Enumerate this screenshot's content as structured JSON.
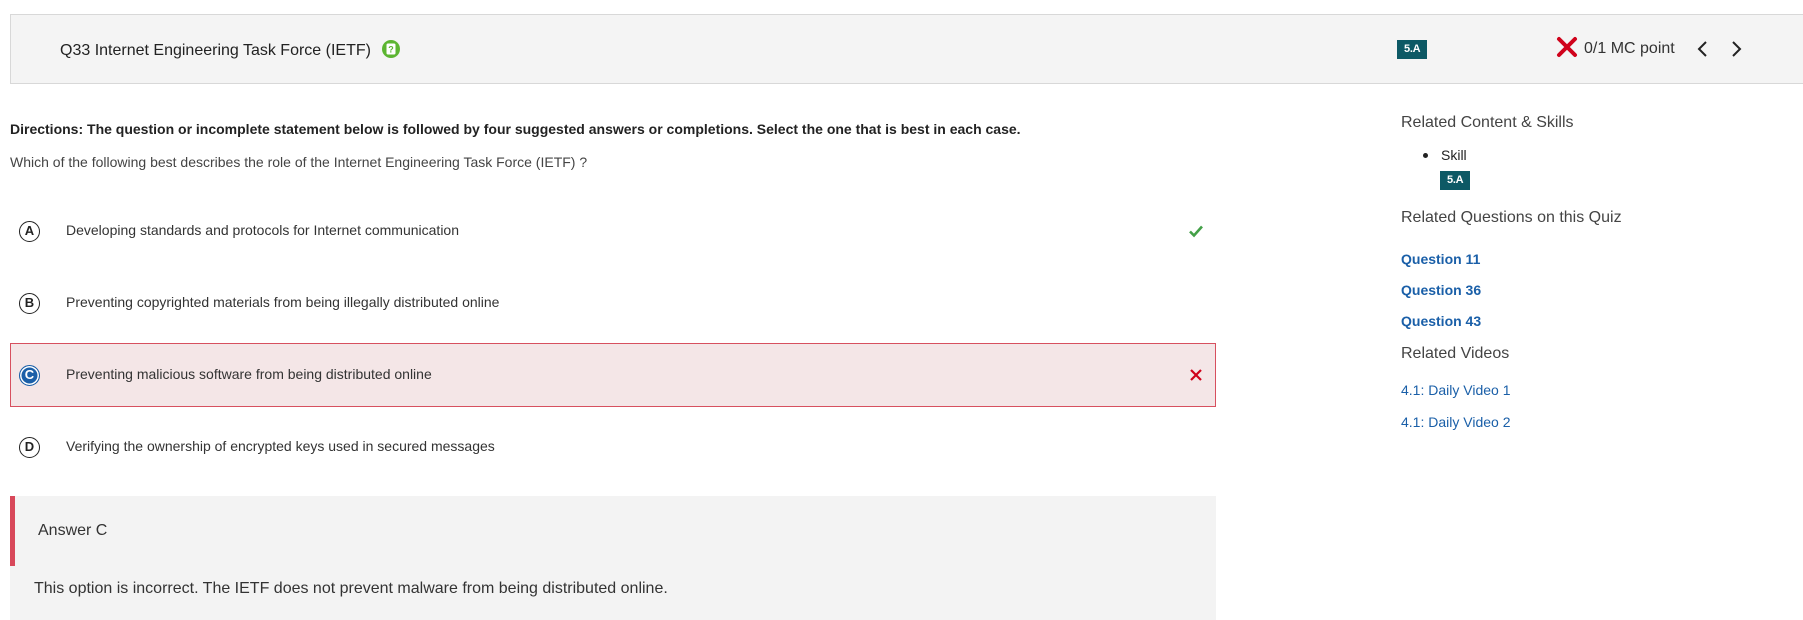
{
  "header": {
    "question_title": "Q33 Internet Engineering Task Force (IETF)",
    "help_icon": "help-question-icon",
    "skill_badge": "5.A",
    "score_icon": "red-x-icon",
    "score_text": "0/1 MC point",
    "prev_icon": "chevron-left-icon",
    "next_icon": "chevron-right-icon"
  },
  "question": {
    "directions": "Directions: The question or incomplete statement below is followed by four suggested answers or completions. Select the one that is best in each case.",
    "prompt": "Which of the following best describes the role of the Internet Engineering Task Force (IETF) ?"
  },
  "options": [
    {
      "letter": "A",
      "text": "Developing standards and protocols for Internet communication",
      "mark": "check-icon",
      "state": "correct"
    },
    {
      "letter": "B",
      "text": "Preventing copyrighted materials from being illegally distributed online",
      "mark": "",
      "state": "none"
    },
    {
      "letter": "C",
      "text": "Preventing malicious software from being distributed online",
      "mark": "x-icon",
      "state": "selected-incorrect"
    },
    {
      "letter": "D",
      "text": "Verifying the ownership of encrypted keys used in secured messages",
      "mark": "",
      "state": "none"
    }
  ],
  "answer": {
    "title": "Answer C",
    "explanation": "This option is incorrect. The IETF does not prevent malware from being distributed online."
  },
  "sidebar": {
    "related_content_heading": "Related Content & Skills",
    "skill_label": "Skill",
    "skill_badge": "5.A",
    "related_questions_heading": "Related Questions on this Quiz",
    "related_questions": [
      "Question 11",
      "Question 36",
      "Question 43"
    ],
    "related_videos_heading": "Related Videos",
    "related_videos": [
      "4.1: Daily Video 1",
      "4.1: Daily Video 2"
    ]
  },
  "colors": {
    "badge": "#0d5965",
    "link": "#1a5fa8",
    "incorrect": "#d0021b",
    "correct": "#43a047",
    "selected_bg": "#f4e6e7",
    "selected_border": "#d7505f"
  }
}
